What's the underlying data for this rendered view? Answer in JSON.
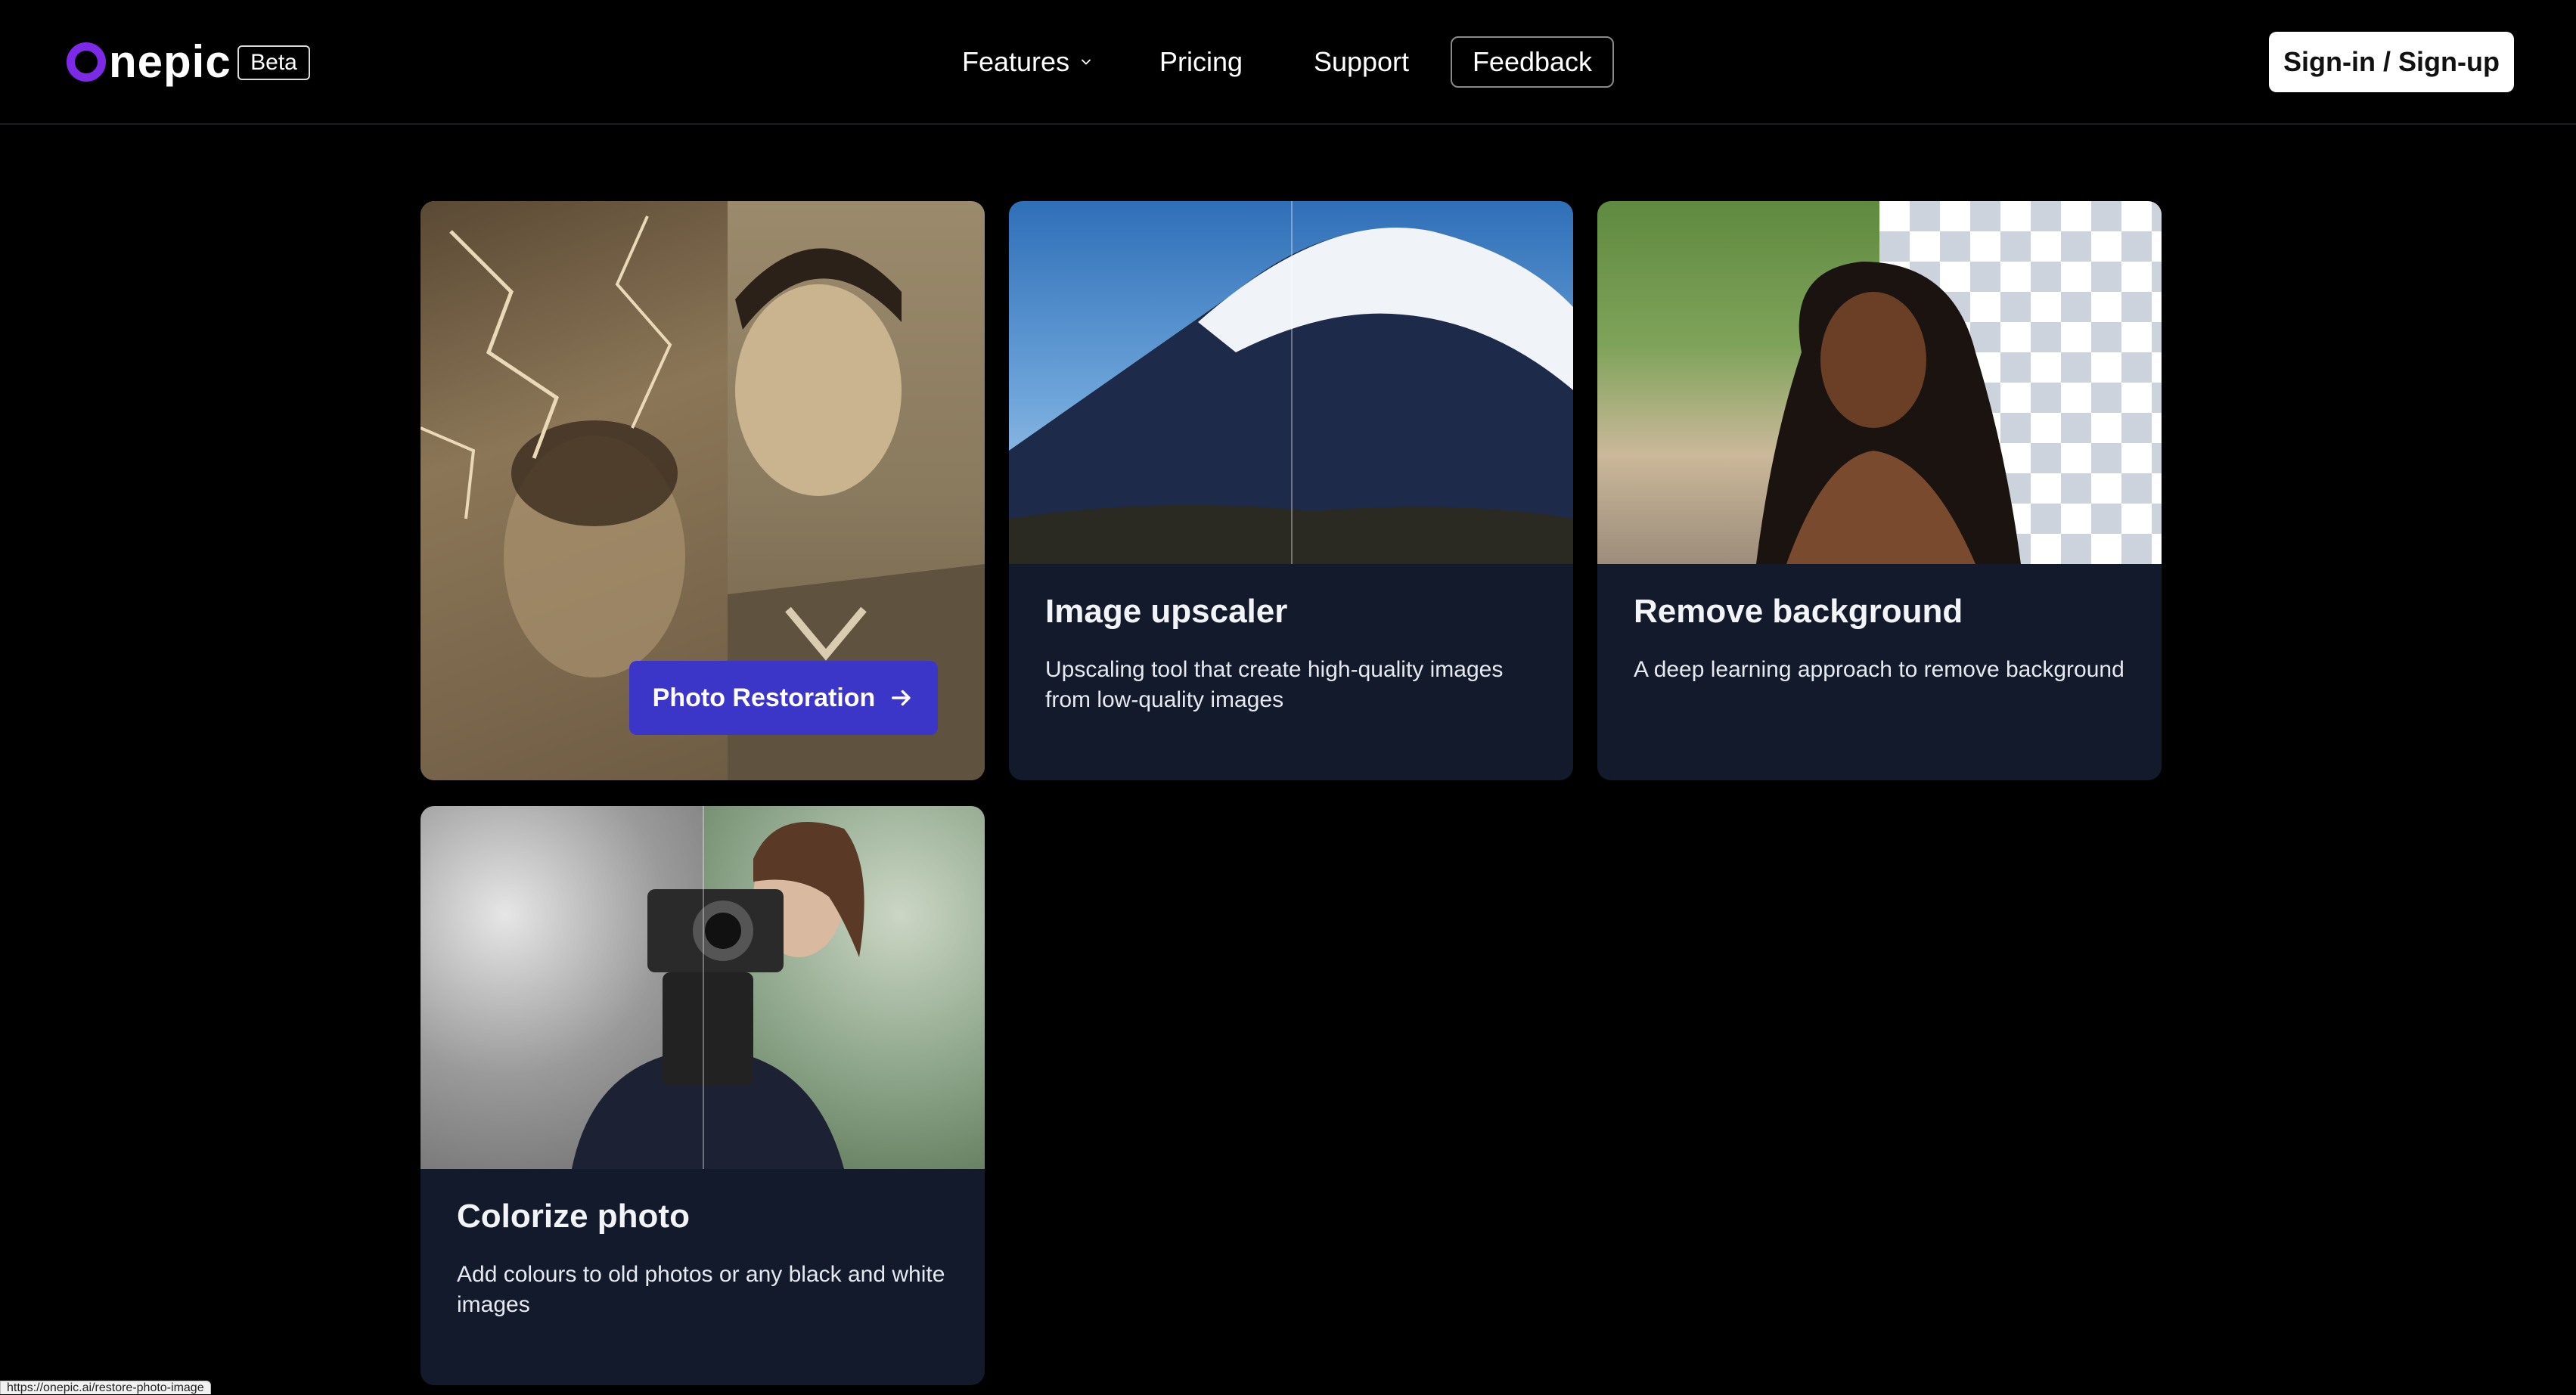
{
  "header": {
    "logo_text": "nepic",
    "beta_label": "Beta",
    "nav": {
      "features": "Features",
      "pricing": "Pricing",
      "support": "Support",
      "feedback": "Feedback"
    },
    "signin_label": "Sign-in / Sign-up"
  },
  "cards": {
    "restore": {
      "button_label": "Photo Restoration"
    },
    "upscale": {
      "title": "Image upscaler",
      "desc": "Upscaling tool that create high-quality images from low-quality images"
    },
    "removebg": {
      "title": "Remove background",
      "desc": "A deep learning approach to remove background"
    },
    "colorize": {
      "title": "Colorize photo",
      "desc": "Add colours to old photos or any black and white images"
    }
  },
  "status_bar": {
    "url": "https://onepic.ai/restore-photo-image"
  },
  "colors": {
    "background": "#000000",
    "card_bg": "#131a2b",
    "cta": "#3b35c8",
    "logo_accent": "#7c2ae8"
  }
}
